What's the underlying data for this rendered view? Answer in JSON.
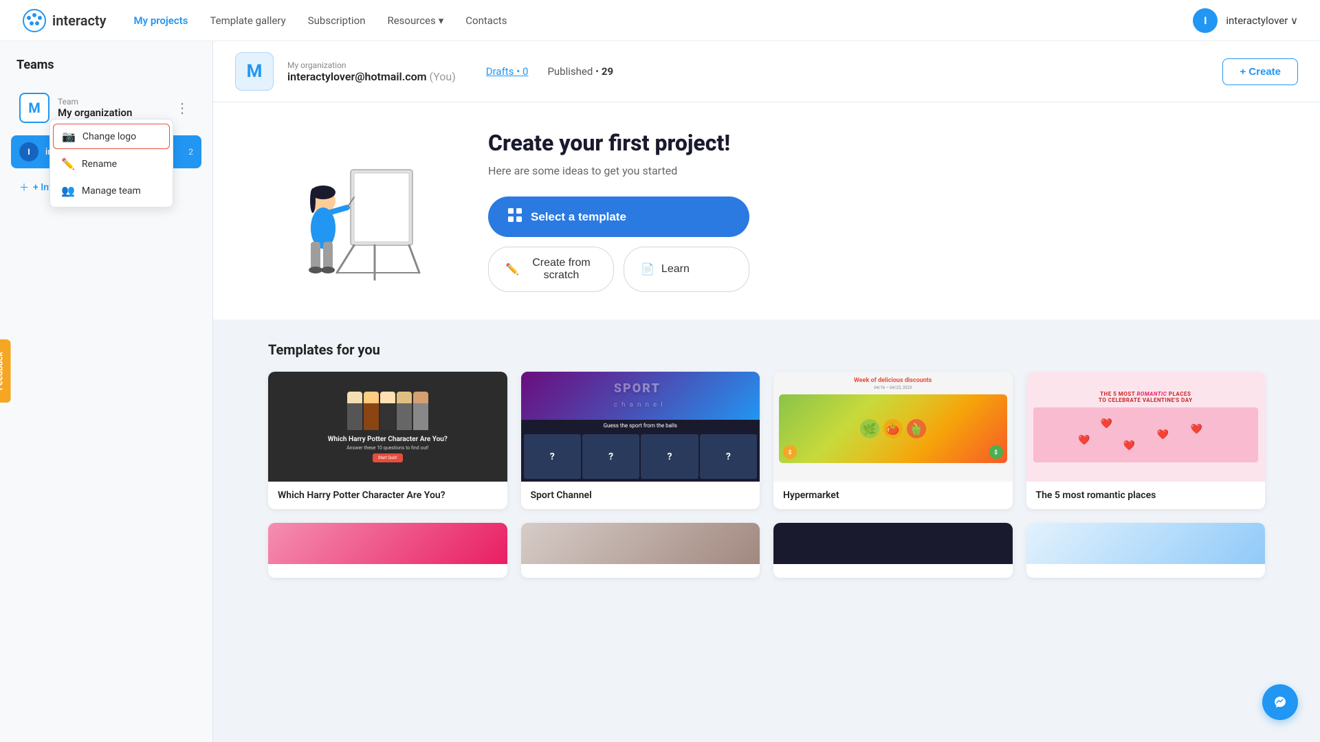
{
  "navbar": {
    "logo_text": "interacty",
    "nav_items": [
      {
        "label": "My projects",
        "active": true
      },
      {
        "label": "Template gallery",
        "active": false
      },
      {
        "label": "Subscription",
        "active": false
      },
      {
        "label": "Resources",
        "active": false,
        "has_dropdown": true
      },
      {
        "label": "Contacts",
        "active": false
      }
    ],
    "user_initial": "I",
    "user_name": "interactylover",
    "chevron": "∨"
  },
  "sidebar": {
    "title": "Teams",
    "team": {
      "avatar_letter": "M",
      "label": "Team",
      "name": "My organization"
    },
    "context_menu": {
      "items": [
        {
          "icon": "📷",
          "label": "Change logo",
          "highlighted": true
        },
        {
          "icon": "✏️",
          "label": "Rename"
        },
        {
          "icon": "👥",
          "label": "Manage team"
        }
      ]
    },
    "member": {
      "initial": "I",
      "email": "interactylover@hotmail.co...",
      "count": "2"
    },
    "invite_label": "+ Invite members"
  },
  "org_header": {
    "avatar_letter": "M",
    "org_name": "My organization",
    "email": "interactylover@hotmail.com",
    "you_label": "(You)",
    "drafts_label": "Drafts",
    "drafts_dot": "•",
    "drafts_count": "0",
    "published_label": "Published",
    "published_dot": "•",
    "published_count": "29",
    "create_btn": "+ Create"
  },
  "hero": {
    "title": "Create your first project!",
    "subtitle": "Here are some ideas to get you started",
    "select_template_label": "Select a template",
    "create_scratch_label": "Create from scratch",
    "learn_label": "Learn"
  },
  "templates_section": {
    "title": "Templates for you",
    "templates": [
      {
        "id": "harry-potter",
        "name": "Which Harry Potter Character Are You?"
      },
      {
        "id": "sport-channel",
        "name": "Sport Channel"
      },
      {
        "id": "hypermarket",
        "name": "Hypermarket",
        "tag": "Week of delicious discounts"
      },
      {
        "id": "romantic",
        "name": "The 5 most romantic places"
      }
    ]
  },
  "feedback": {
    "label": "Feedback"
  }
}
